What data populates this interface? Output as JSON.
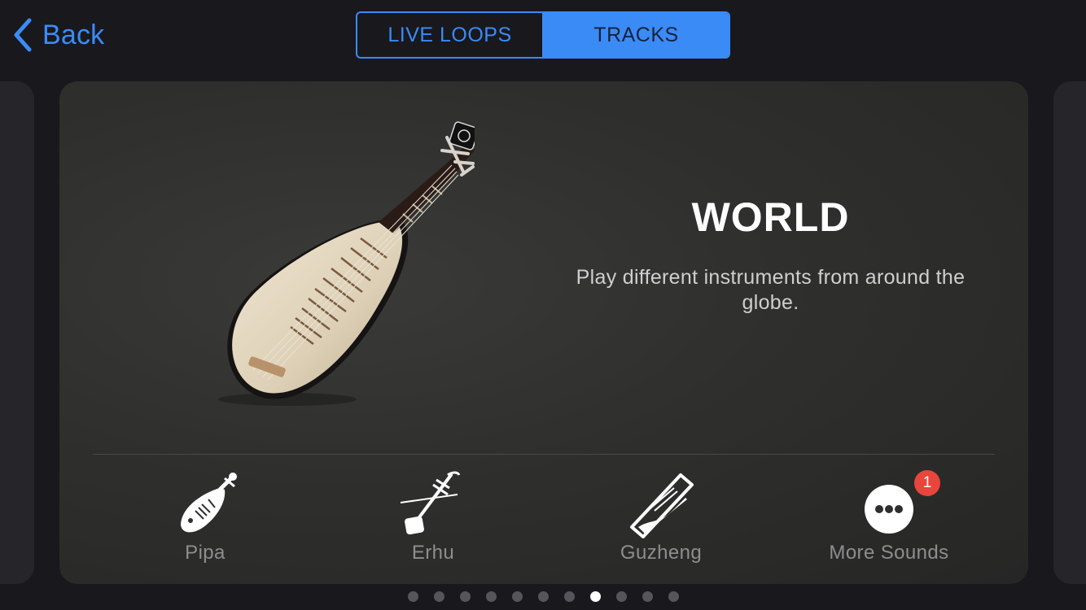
{
  "nav": {
    "back_label": "Back"
  },
  "segmented_control": {
    "options": [
      "LIVE LOOPS",
      "TRACKS"
    ],
    "selected": "TRACKS"
  },
  "card": {
    "title": "WORLD",
    "description": "Play different instruments from around the globe."
  },
  "sounds": [
    {
      "label": "Pipa",
      "icon": "pipa-icon"
    },
    {
      "label": "Erhu",
      "icon": "erhu-icon"
    },
    {
      "label": "Guzheng",
      "icon": "guzheng-icon"
    },
    {
      "label": "More Sounds",
      "icon": "more-icon",
      "badge": "1"
    }
  ],
  "pagination": {
    "count": 11,
    "active_index": 7
  },
  "colors": {
    "accent": "#3b8bf7",
    "background": "#18181d",
    "badge": "#e8453c"
  }
}
